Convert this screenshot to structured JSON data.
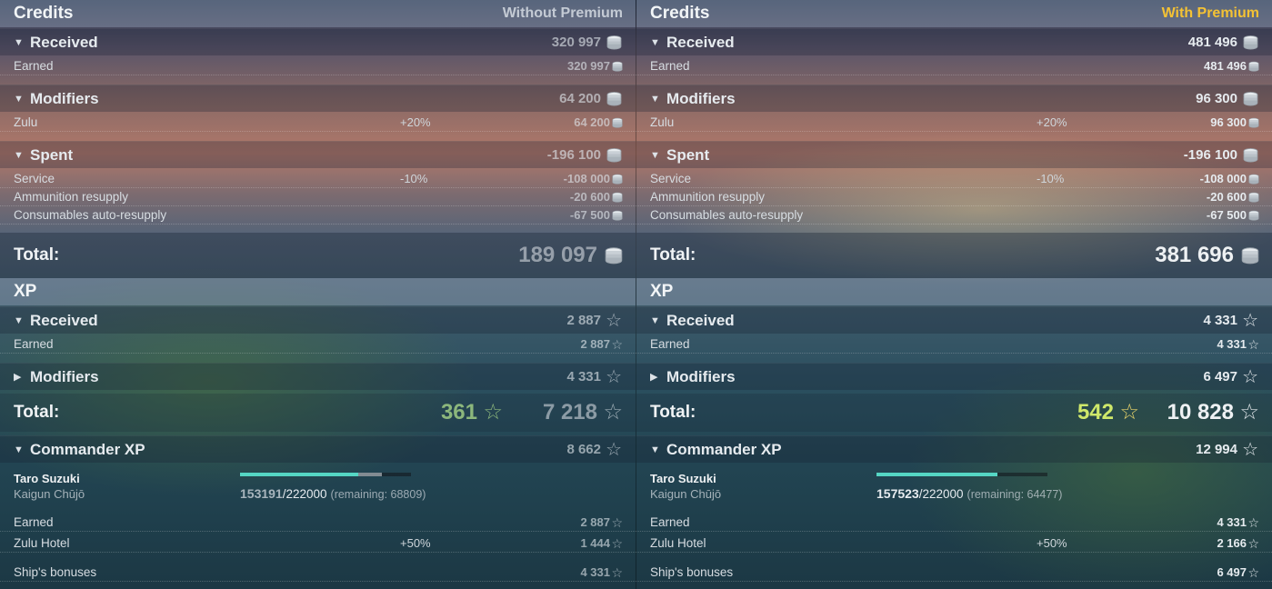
{
  "columns": [
    {
      "key": "without",
      "credits": {
        "title": "Credits",
        "subtitle": "Without Premium",
        "received": {
          "label": "Received",
          "value": "320 997"
        },
        "received_items": [
          {
            "label": "Earned",
            "pct": "",
            "value": "320 997"
          }
        ],
        "modifiers": {
          "label": "Modifiers",
          "value": "64 200"
        },
        "modifiers_items": [
          {
            "label": "Zulu",
            "pct": "+20%",
            "value": "64 200"
          }
        ],
        "spent": {
          "label": "Spent",
          "value": "-196 100"
        },
        "spent_items": [
          {
            "label": "Service",
            "pct": "-10%",
            "value": "-108 000"
          },
          {
            "label": "Ammunition resupply",
            "pct": "",
            "value": "-20 600"
          },
          {
            "label": "Consumables auto-resupply",
            "pct": "",
            "value": "-67 500"
          }
        ],
        "total": {
          "label": "Total:",
          "value": "189 097"
        }
      },
      "xp": {
        "title": "XP",
        "received": {
          "label": "Received",
          "value": "2 887"
        },
        "received_items": [
          {
            "label": "Earned",
            "value": "2 887"
          }
        ],
        "modifiers": {
          "label": "Modifiers",
          "value": "4 331"
        },
        "total": {
          "label": "Total:",
          "free_value": "361",
          "value": "7 218"
        }
      },
      "commander": {
        "label": "Commander XP",
        "value": "8 662",
        "name": "Taro Suzuki",
        "rank": "Kaigun Chūjō",
        "progress_current": "153191",
        "progress_max": "/222000",
        "remaining": "(remaining: 68809)",
        "progress_fraction": 0.69,
        "progress_prev_fraction": 0.69,
        "progress_gain_fraction": 0.83,
        "items": [
          {
            "label": "Earned",
            "pct": "",
            "value": "2 887"
          },
          {
            "label": "Zulu Hotel",
            "pct": "+50%",
            "value": "1 444"
          },
          {
            "label": "Ship's bonuses",
            "pct": "",
            "value": "4 331"
          }
        ]
      }
    },
    {
      "key": "with",
      "credits": {
        "title": "Credits",
        "subtitle": "With Premium",
        "received": {
          "label": "Received",
          "value": "481 496"
        },
        "received_items": [
          {
            "label": "Earned",
            "pct": "",
            "value": "481 496"
          }
        ],
        "modifiers": {
          "label": "Modifiers",
          "value": "96 300"
        },
        "modifiers_items": [
          {
            "label": "Zulu",
            "pct": "+20%",
            "value": "96 300"
          }
        ],
        "spent": {
          "label": "Spent",
          "value": "-196 100"
        },
        "spent_items": [
          {
            "label": "Service",
            "pct": "-10%",
            "value": "-108 000"
          },
          {
            "label": "Ammunition resupply",
            "pct": "",
            "value": "-20 600"
          },
          {
            "label": "Consumables auto-resupply",
            "pct": "",
            "value": "-67 500"
          }
        ],
        "total": {
          "label": "Total:",
          "value": "381 696"
        }
      },
      "xp": {
        "title": "XP",
        "received": {
          "label": "Received",
          "value": "4 331"
        },
        "received_items": [
          {
            "label": "Earned",
            "value": "4 331"
          }
        ],
        "modifiers": {
          "label": "Modifiers",
          "value": "6 497"
        },
        "total": {
          "label": "Total:",
          "free_value": "542",
          "value": "10 828"
        }
      },
      "commander": {
        "label": "Commander XP",
        "value": "12 994",
        "name": "Taro Suzuki",
        "rank": "Kaigun Chūjō",
        "progress_current": "157523",
        "progress_max": "/222000",
        "remaining": "(remaining: 64477)",
        "progress_fraction": 0.71,
        "progress_prev_fraction": 0.71,
        "progress_gain_fraction": 0.71,
        "items": [
          {
            "label": "Earned",
            "pct": "",
            "value": "4 331"
          },
          {
            "label": "Zulu Hotel",
            "pct": "+50%",
            "value": "2 166"
          },
          {
            "label": "Ship's bonuses",
            "pct": "",
            "value": "6 497"
          }
        ]
      }
    }
  ],
  "colors": {
    "premium_gold": "#f4c234",
    "free_xp_green": "#cfe86a",
    "free_xp_green_dim": "#8cb77c",
    "progress_teal": "#55d6c4"
  },
  "icons": {
    "credits": "coin-stack-icon",
    "xp": "star-outline-icon",
    "expanded": "caret-down-icon",
    "collapsed": "caret-right-icon"
  }
}
